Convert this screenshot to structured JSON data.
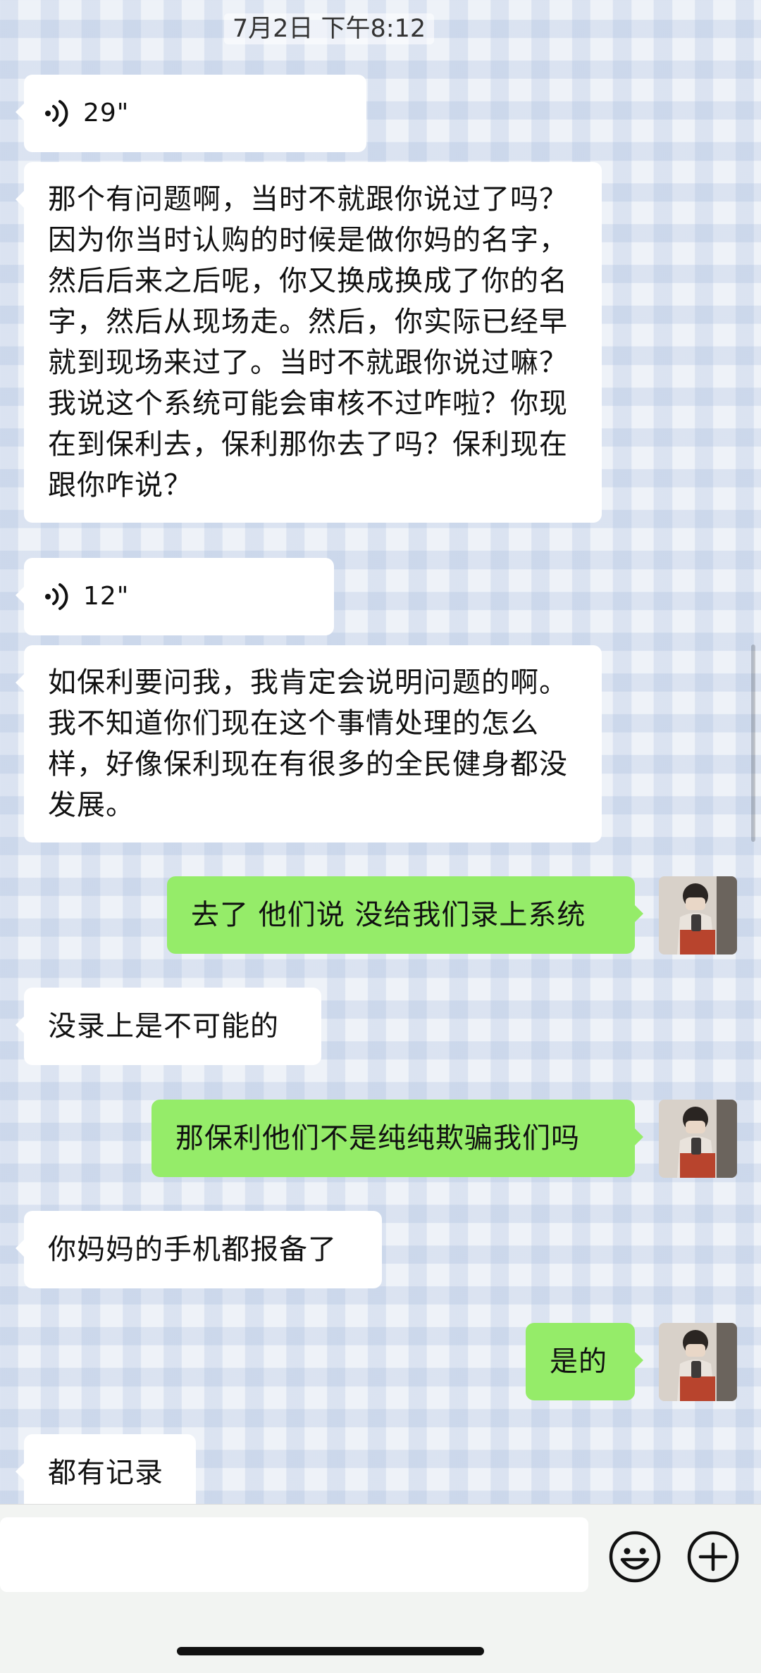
{
  "timestamp": "7月2日 下午8:12",
  "messages": {
    "m1": {
      "sender": "other",
      "type": "voice",
      "duration": "29\""
    },
    "m2": {
      "sender": "other",
      "type": "text",
      "text": "那个有问题啊，当时不就跟你说过了吗？因为你当时认购的时候是做你妈的名字，然后后来之后呢，你又换成换成了你的名字，然后从现场走。然后，你实际已经早就到现场来过了。当时不就跟你说过嘛？我说这个系统可能会审核不过咋啦？你现在到保利去，保利那你去了吗？保利现在跟你咋说？"
    },
    "m3": {
      "sender": "other",
      "type": "voice",
      "duration": "12\""
    },
    "m4": {
      "sender": "other",
      "type": "text",
      "text": "如保利要问我，我肯定会说明问题的啊。我不知道你们现在这个事情处理的怎么样，好像保利现在有很多的全民健身都没发展。"
    },
    "m5": {
      "sender": "me",
      "type": "text",
      "text": "去了 他们说 没给我们录上系统"
    },
    "m6": {
      "sender": "other",
      "type": "text",
      "text": "没录上是不可能的"
    },
    "m7": {
      "sender": "me",
      "type": "text",
      "text": "那保利他们不是纯纯欺骗我们吗"
    },
    "m8": {
      "sender": "other",
      "type": "text",
      "text": "你妈妈的手机都报备了"
    },
    "m9": {
      "sender": "me",
      "type": "text",
      "text": "是的"
    },
    "m10": {
      "sender": "other",
      "type": "text",
      "text": "都有记录"
    }
  },
  "input_bar": {
    "placeholder": "",
    "emoji_icon": "emoji-icon",
    "add_icon": "plus-circle-icon"
  },
  "colors": {
    "outgoing_bubble": "#95ec69",
    "incoming_bubble": "#ffffff"
  }
}
